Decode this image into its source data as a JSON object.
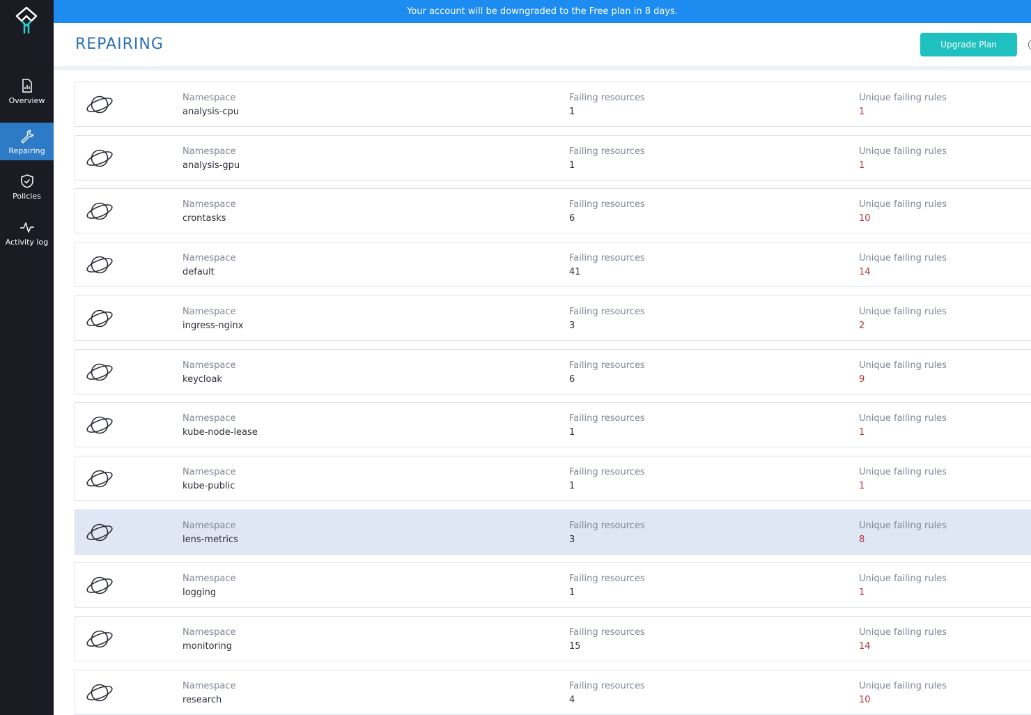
{
  "sidebar": {
    "items": [
      {
        "label": "Overview",
        "icon": "chart-file-icon",
        "active": false
      },
      {
        "label": "Repairing",
        "icon": "wrench-icon",
        "active": true
      },
      {
        "label": "Policies",
        "icon": "shield-icon",
        "active": false
      },
      {
        "label": "Activity log",
        "icon": "pulse-icon",
        "active": false
      }
    ]
  },
  "banner": {
    "text": "Your account will be downgraded to the Free plan in 8 days."
  },
  "header": {
    "title": "REPAIRING",
    "upgrade_label": "Upgrade Plan"
  },
  "columns": {
    "c1": "Namespace",
    "c2": "Failing resources",
    "c3": "Unique failing rules"
  },
  "rows": [
    {
      "namespace": "analysis-cpu",
      "failing_resources": "1",
      "unique_failing_rules": "1"
    },
    {
      "namespace": "analysis-gpu",
      "failing_resources": "1",
      "unique_failing_rules": "1"
    },
    {
      "namespace": "crontasks",
      "failing_resources": "6",
      "unique_failing_rules": "10"
    },
    {
      "namespace": "default",
      "failing_resources": "41",
      "unique_failing_rules": "14"
    },
    {
      "namespace": "ingress-nginx",
      "failing_resources": "3",
      "unique_failing_rules": "2"
    },
    {
      "namespace": "keycloak",
      "failing_resources": "6",
      "unique_failing_rules": "9"
    },
    {
      "namespace": "kube-node-lease",
      "failing_resources": "1",
      "unique_failing_rules": "1"
    },
    {
      "namespace": "kube-public",
      "failing_resources": "1",
      "unique_failing_rules": "1"
    },
    {
      "namespace": "lens-metrics",
      "failing_resources": "3",
      "unique_failing_rules": "8"
    },
    {
      "namespace": "logging",
      "failing_resources": "1",
      "unique_failing_rules": "1"
    },
    {
      "namespace": "monitoring",
      "failing_resources": "15",
      "unique_failing_rules": "14"
    },
    {
      "namespace": "research",
      "failing_resources": "4",
      "unique_failing_rules": "10"
    }
  ],
  "highlighted_row": "lens-metrics",
  "colors": {
    "accent": "#1ec1c0",
    "banner": "#1d8cf0",
    "sidebar": "#1b1b24",
    "active_nav": "#2d7bc7",
    "highlight_row": "#dfe6f4",
    "rules_value": "#b0333b"
  }
}
